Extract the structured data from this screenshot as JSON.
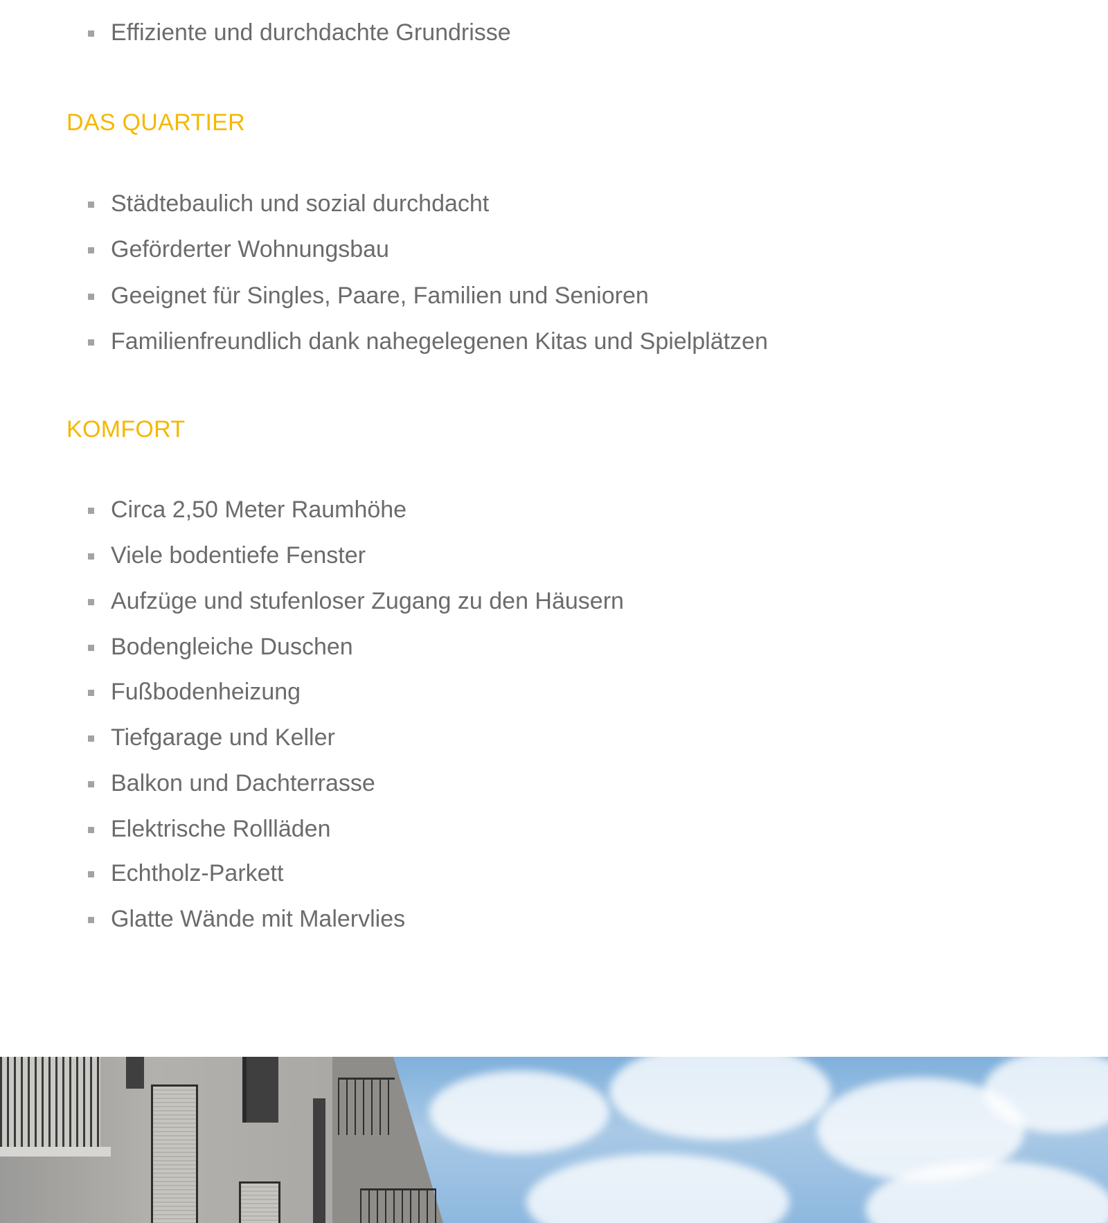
{
  "top_list": {
    "items": [
      "Effiziente und durchdachte Grundrisse"
    ]
  },
  "quartier": {
    "heading": "DAS QUARTIER",
    "items": [
      "Städtebaulich und sozial durchdacht",
      "Geförderter Wohnungsbau",
      "Geeignet für Singles, Paare, Familien und Senioren",
      "Familienfreundlich dank nahegelegenen Kitas und Spielplätzen"
    ]
  },
  "komfort": {
    "heading": "KOMFORT",
    "items": [
      "Circa 2,50 Meter Raumhöhe",
      "Viele bodentiefe Fenster",
      "Aufzüge und stufenloser Zugang zu den Häusern",
      "Bodengleiche Duschen",
      "Fußbodenheizung",
      "Tiefgarage und Keller",
      "Balkon und Dachterrasse",
      "Elektrische Rollläden",
      "Echtholz-Parkett",
      "Glatte Wände mit Malervlies"
    ]
  },
  "colors": {
    "heading": "#f5b700",
    "text": "#6b6b6b",
    "bullet": "#a3a3a3"
  }
}
